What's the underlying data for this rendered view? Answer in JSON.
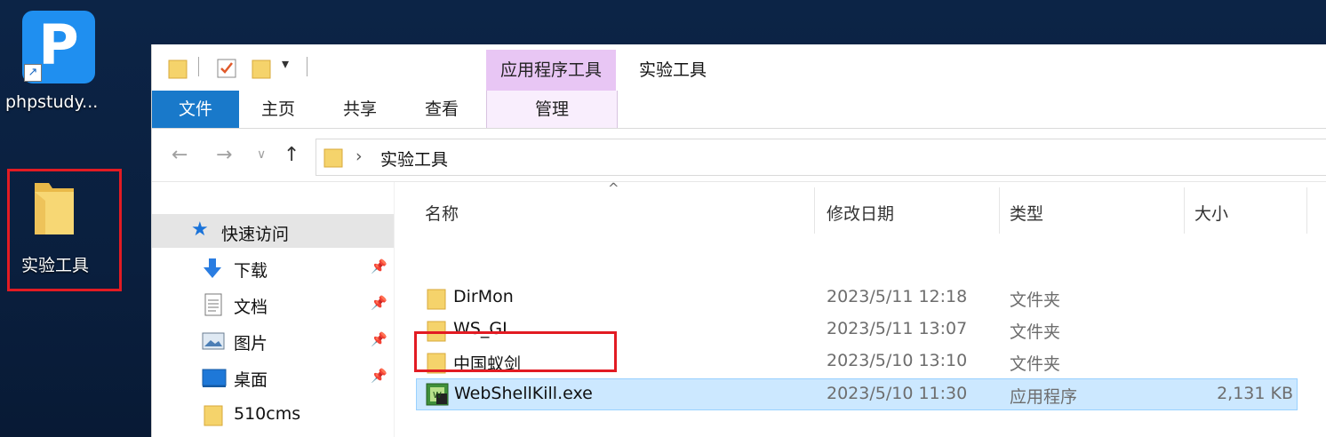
{
  "desktop": {
    "icons": [
      {
        "label": "phpstudy..."
      },
      {
        "label": "实验工具"
      }
    ],
    "php_letter": "P"
  },
  "window": {
    "title": "实验工具",
    "contextual_tab_header": "应用程序工具",
    "ribbon_tabs": [
      "文件",
      "主页",
      "共享",
      "查看",
      "管理"
    ],
    "address": {
      "breadcrumb": "实验工具"
    },
    "nav_pane": {
      "items": [
        {
          "label": "快速访问",
          "icon": "star-icon"
        },
        {
          "label": "下载",
          "icon": "download-arrow-icon",
          "pinned": true
        },
        {
          "label": "文档",
          "icon": "document-icon",
          "pinned": true
        },
        {
          "label": "图片",
          "icon": "picture-icon",
          "pinned": true
        },
        {
          "label": "桌面",
          "icon": "desktop-icon",
          "pinned": true
        },
        {
          "label": "510cms",
          "icon": "folder-icon"
        }
      ]
    },
    "file_list": {
      "columns": [
        "名称",
        "修改日期",
        "类型",
        "大小"
      ],
      "rows": [
        {
          "name": "DirMon",
          "date": "2023/5/11 12:18",
          "type": "文件夹",
          "size": ""
        },
        {
          "name": "WS_GL",
          "date": "2023/5/11 13:07",
          "type": "文件夹",
          "size": ""
        },
        {
          "name": "中国蚁剑",
          "date": "2023/5/10 13:10",
          "type": "文件夹",
          "size": ""
        },
        {
          "name": "WebShellKill.exe",
          "date": "2023/5/10 11:30",
          "type": "应用程序",
          "size": "2,131 KB",
          "selected": true
        }
      ]
    }
  },
  "colors": {
    "desktop_bg": "#0c2446",
    "file_tab": "#1979ca",
    "contextual_tab": "#e8c6f4",
    "selection": "#cce8ff",
    "highlight_box": "#e21b23",
    "folder": "#f5d36b"
  }
}
